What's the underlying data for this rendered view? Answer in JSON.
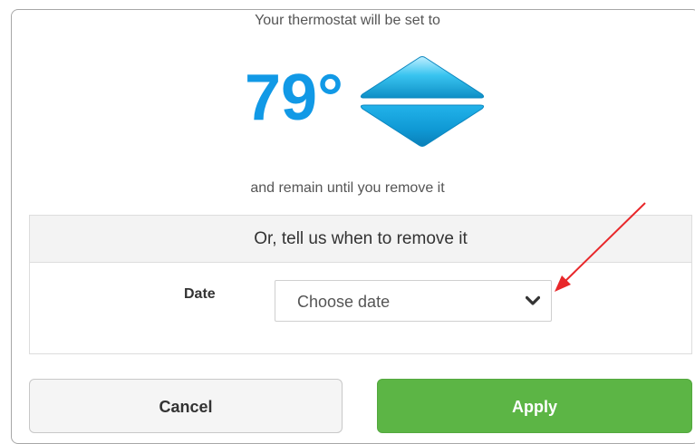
{
  "dialog": {
    "heading": "Your thermostat will be set to",
    "temperature": "79°",
    "subtext": "and remain until you remove it",
    "accent_color": "#1199e6"
  },
  "remove_section": {
    "header": "Or, tell us when to remove it",
    "date_label": "Date",
    "date_select": {
      "value": "Choose date",
      "icon": "chevron-down-icon"
    }
  },
  "buttons": {
    "cancel_label": "Cancel",
    "apply_label": "Apply",
    "apply_color": "#5cb545"
  },
  "annotation": {
    "arrow_color": "#e8272a"
  }
}
